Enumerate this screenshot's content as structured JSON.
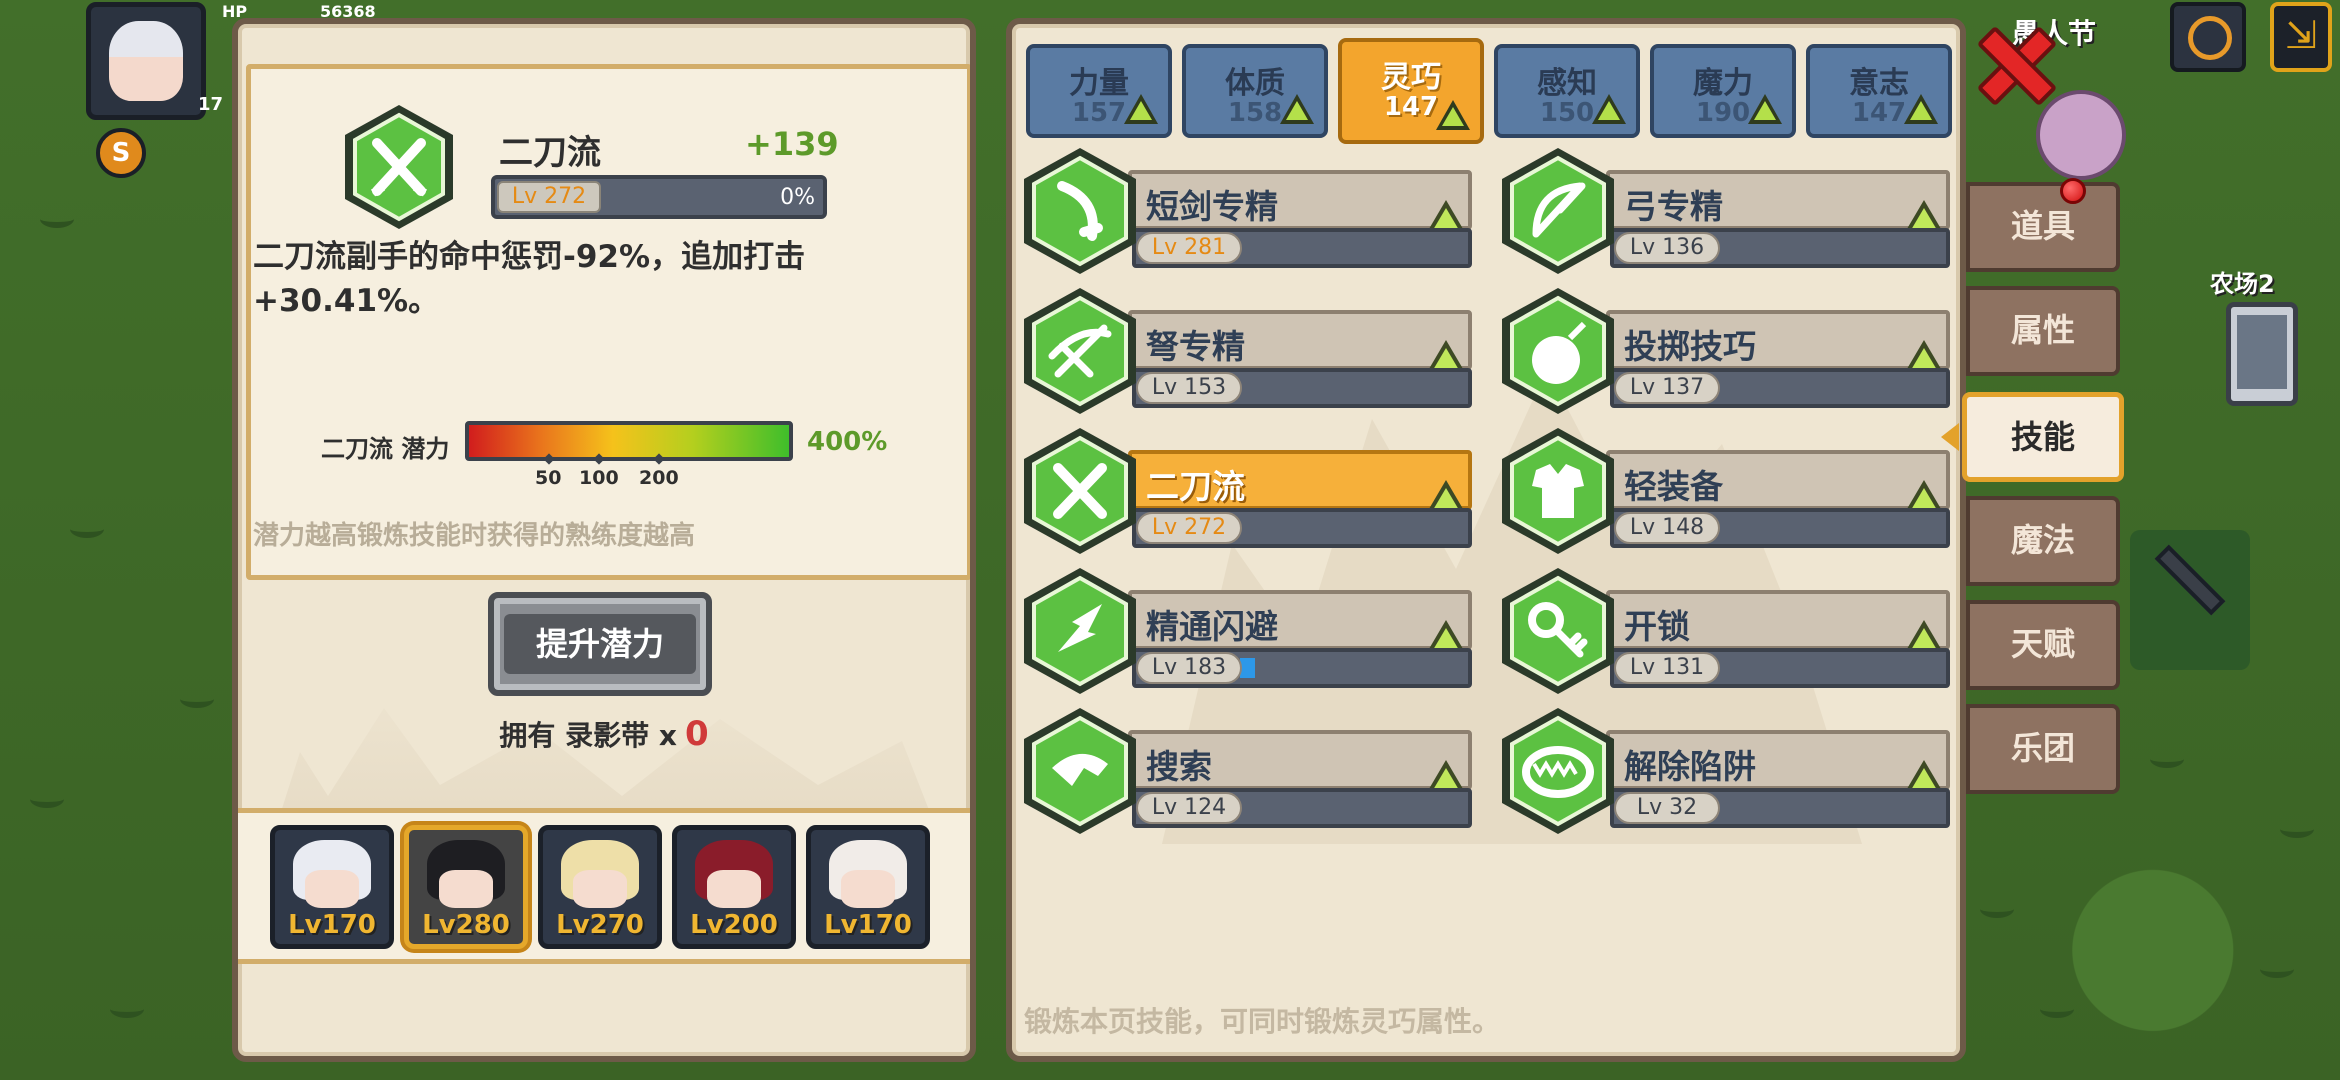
{
  "hud": {
    "hp_label": "HP",
    "hp_value": "56368",
    "level": "17",
    "event_label": "愚人节",
    "farm_label": "农场2"
  },
  "detail": {
    "skill_name": "二刀流",
    "bonus": "+139",
    "level": "Lv 272",
    "progress_pct": "0%",
    "progress": 0,
    "description": "二刀流副手的命中惩罚-92%，追加打击+30.41%。",
    "potential_label": "二刀流 潜力",
    "potential_ticks": [
      "50",
      "100",
      "200"
    ],
    "potential_value": "400%",
    "potential_hint": "潜力越高锻炼技能时获得的熟练度越高",
    "upgrade_button": "提升潜力",
    "owned_label": "拥有 录影带 x",
    "owned_count": "0"
  },
  "party": [
    {
      "level": "Lv170",
      "hair": "#e9ebf2",
      "selected": false
    },
    {
      "level": "Lv280",
      "hair": "#1e1e22",
      "selected": true
    },
    {
      "level": "Lv270",
      "hair": "#eedfa8",
      "selected": false
    },
    {
      "level": "Lv200",
      "hair": "#8a1c2a",
      "selected": false
    },
    {
      "level": "Lv170",
      "hair": "#f1ece8",
      "selected": false
    }
  ],
  "attributes": [
    {
      "name": "力量",
      "value": "157",
      "active": false
    },
    {
      "name": "体质",
      "value": "158",
      "active": false
    },
    {
      "name": "灵巧",
      "value": "147",
      "active": true
    },
    {
      "name": "感知",
      "value": "150",
      "active": false
    },
    {
      "name": "魔力",
      "value": "190",
      "active": false
    },
    {
      "name": "意志",
      "value": "147",
      "active": false
    }
  ],
  "skills": [
    {
      "name": "短剑专精",
      "level": "Lv 281",
      "progress": 0,
      "icon": "dagger-icon",
      "orange": true,
      "selected": false
    },
    {
      "name": "弓专精",
      "level": "Lv 136",
      "progress": 0,
      "icon": "bow-icon",
      "orange": false,
      "selected": false
    },
    {
      "name": "弩专精",
      "level": "Lv 153",
      "progress": 0,
      "icon": "crossbow-icon",
      "orange": false,
      "selected": false
    },
    {
      "name": "投掷技巧",
      "level": "Lv 137",
      "progress": 0,
      "icon": "throwing-bomb-icon",
      "orange": false,
      "selected": false
    },
    {
      "name": "二刀流",
      "level": "Lv 272",
      "progress": 0,
      "icon": "dual-wield-icon",
      "orange": true,
      "selected": true
    },
    {
      "name": "轻装备",
      "level": "Lv 148",
      "progress": 0,
      "icon": "light-armor-icon",
      "orange": false,
      "selected": false
    },
    {
      "name": "精通闪避",
      "level": "Lv 183",
      "progress": 0.07,
      "icon": "dodge-icon",
      "orange": false,
      "selected": false
    },
    {
      "name": "开锁",
      "level": "Lv 131",
      "progress": 0,
      "icon": "key-icon",
      "orange": false,
      "selected": false
    },
    {
      "name": "搜索",
      "level": "Lv 124",
      "progress": 0,
      "icon": "search-icon",
      "orange": false,
      "selected": false
    },
    {
      "name": "解除陷阱",
      "level": "Lv 32",
      "progress": 0,
      "icon": "trap-icon",
      "orange": false,
      "selected": false
    }
  ],
  "footer_hint": "锻炼本页技能，可同时锻炼灵巧属性。",
  "side_tabs": [
    {
      "label": "道具",
      "active": false
    },
    {
      "label": "属性",
      "active": false
    },
    {
      "label": "技能",
      "active": true
    },
    {
      "label": "魔法",
      "active": false
    },
    {
      "label": "天赋",
      "active": false
    },
    {
      "label": "乐团",
      "active": false
    }
  ],
  "colors": {
    "hex_green": "#4bb83a",
    "accent_orange": "#f3a52d",
    "xp_blue": "#2d98e8"
  }
}
